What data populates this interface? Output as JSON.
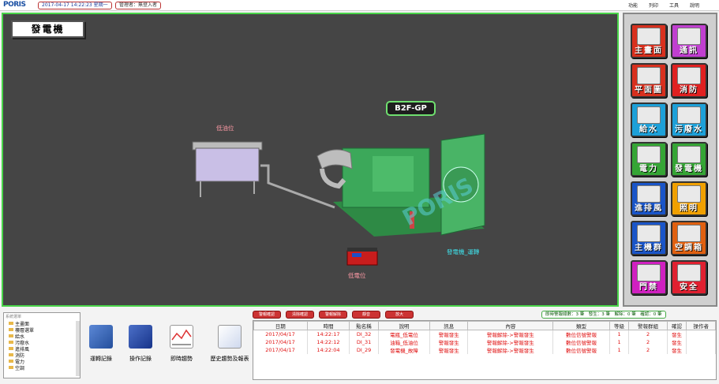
{
  "header": {
    "logo": "PORIS",
    "datetime": "2017-04-17 14:22:23 星期一",
    "user": "管理者：無登入者",
    "menus": [
      "功能",
      "列印",
      "工具",
      "說明"
    ]
  },
  "main": {
    "title": "發電機",
    "tag": "B2F-GP",
    "labels": {
      "low_oil": "低油位",
      "low_level": "低電位",
      "gen_running": "發電機_運轉"
    },
    "watermark": "PORIS"
  },
  "sidebar": {
    "tiles": [
      {
        "label": "主畫面",
        "color": "#d8301e"
      },
      {
        "label": "通訊",
        "color": "#c03fd0"
      },
      {
        "label": "平面圖",
        "color": "#d8301e"
      },
      {
        "label": "消防",
        "color": "#e02020"
      },
      {
        "label": "給水",
        "color": "#1da0d8"
      },
      {
        "label": "污廢水",
        "color": "#1da0d8"
      },
      {
        "label": "電力",
        "color": "#35a535"
      },
      {
        "label": "發電機",
        "color": "#35a535"
      },
      {
        "label": "進排風",
        "color": "#1a55c8"
      },
      {
        "label": "照明",
        "color": "#f0a000"
      },
      {
        "label": "主機群",
        "color": "#1a55c8"
      },
      {
        "label": "空調箱",
        "color": "#e06010"
      },
      {
        "label": "門禁",
        "color": "#d020c0"
      },
      {
        "label": "安全",
        "color": "#e02030"
      }
    ]
  },
  "tree": {
    "header": "系統選單",
    "items": [
      "主畫面",
      "樓層選單",
      "給水",
      "污廢水",
      "進排風",
      "消防",
      "電力",
      "空調"
    ]
  },
  "tools": [
    {
      "label": "運轉記錄",
      "icon": "calendar-icon"
    },
    {
      "label": "操作記錄",
      "icon": "notebook-icon"
    },
    {
      "label": "即時趨勢",
      "icon": "trend-icon"
    },
    {
      "label": "歷史趨勢及報表",
      "icon": "report-icon"
    }
  ],
  "alarm_buttons": [
    "警報確認",
    "清除確認",
    "警報解除",
    "靜音",
    "放大"
  ],
  "alarm_status": "即時警報總數：3 筆　發生：3 筆　解除：0 筆　確認：0 筆",
  "alarm_table": {
    "headers": [
      "日期",
      "時間",
      "點名稱",
      "說明",
      "訊息",
      "內容",
      "類型",
      "等級",
      "警報群組",
      "確認",
      "操作者"
    ],
    "rows": [
      [
        "2017/04/17",
        "14:22:17",
        "DI_32",
        "電瓶_低電位",
        "警報發生",
        "警報解除->警報發生",
        "數位信號警報",
        "1",
        "2",
        "發生",
        ""
      ],
      [
        "2017/04/17",
        "14:22:12",
        "DI_31",
        "油箱_低油位",
        "警報發生",
        "警報解除->警報發生",
        "數位信號警報",
        "1",
        "2",
        "發生",
        ""
      ],
      [
        "2017/04/17",
        "14:22:04",
        "DI_29",
        "發電機_故障",
        "警報發生",
        "警報解除->警報發生",
        "數位信號警報",
        "1",
        "2",
        "發生",
        ""
      ]
    ]
  }
}
